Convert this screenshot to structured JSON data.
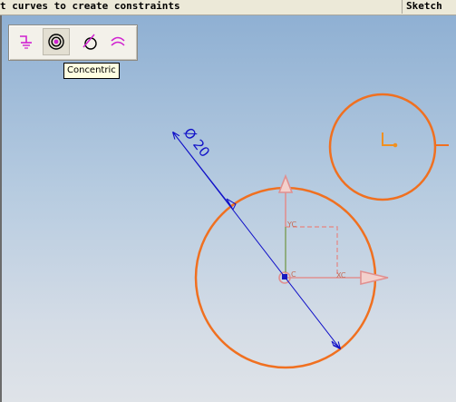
{
  "status_bar": {
    "prompt": "t curves to create constraints",
    "mode": "Sketch"
  },
  "toolbar": {
    "buttons": [
      {
        "name": "coincident-ground-icon"
      },
      {
        "name": "concentric-icon"
      },
      {
        "name": "tangent-icon"
      },
      {
        "name": "parallel-arcs-icon"
      }
    ],
    "active_index": 1
  },
  "tooltip": {
    "text": "Concentric"
  },
  "sketch": {
    "dimension_label": "Ø 20",
    "axis_labels": {
      "y": "YC",
      "x": "XC",
      "z": "C"
    }
  },
  "colors": {
    "curve": "#f07020",
    "dimension": "#1010c8",
    "datum_axis": "#e09090",
    "selected_point": "#1818c0"
  }
}
